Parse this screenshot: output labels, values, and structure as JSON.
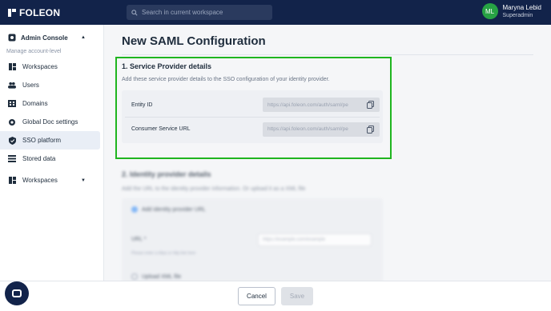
{
  "header": {
    "logo_text": "FOLEON",
    "search_placeholder": "Search in current workspace",
    "user_initials": "ML",
    "user_name": "Maryna Lebid",
    "user_role": "Superadmin"
  },
  "sidebar": {
    "console_label": "Admin Console",
    "manage_label": "Manage account-level",
    "items": [
      {
        "label": "Workspaces",
        "icon": "dashboard-icon"
      },
      {
        "label": "Users",
        "icon": "users-icon"
      },
      {
        "label": "Domains",
        "icon": "domains-icon"
      },
      {
        "label": "Global Doc settings",
        "icon": "gear-icon"
      },
      {
        "label": "SSO platform",
        "icon": "shield-icon"
      },
      {
        "label": "Stored data",
        "icon": "database-icon"
      }
    ],
    "workspaces_label": "Workspaces"
  },
  "main": {
    "title": "New SAML Configuration",
    "service_provider": {
      "title": "1. Service Provider details",
      "description": "Add these service provider details to the SSO configuration of your identity provider.",
      "rows": [
        {
          "label": "Entity ID",
          "value": "https://api.foleon.com/auth/saml/pe"
        },
        {
          "label": "Consumer Service URL",
          "value": "https://api.foleon.com/auth/saml/pe"
        }
      ]
    },
    "identity_provider": {
      "title": "2. Identity provider details",
      "description": "Add the URL to the identity provider information. Or upload it as a XML file",
      "option_url": "Add identity provider URL",
      "url_label": "URL *",
      "url_placeholder": "https://example.com/example",
      "url_help": "Please enter a https or http link here",
      "option_upload": "Upload XML file"
    }
  },
  "footer": {
    "cancel_label": "Cancel",
    "save_label": "Save"
  },
  "colors": {
    "topbar": "#12234a",
    "highlight_border": "#1fb51f",
    "avatar": "#27a244"
  }
}
